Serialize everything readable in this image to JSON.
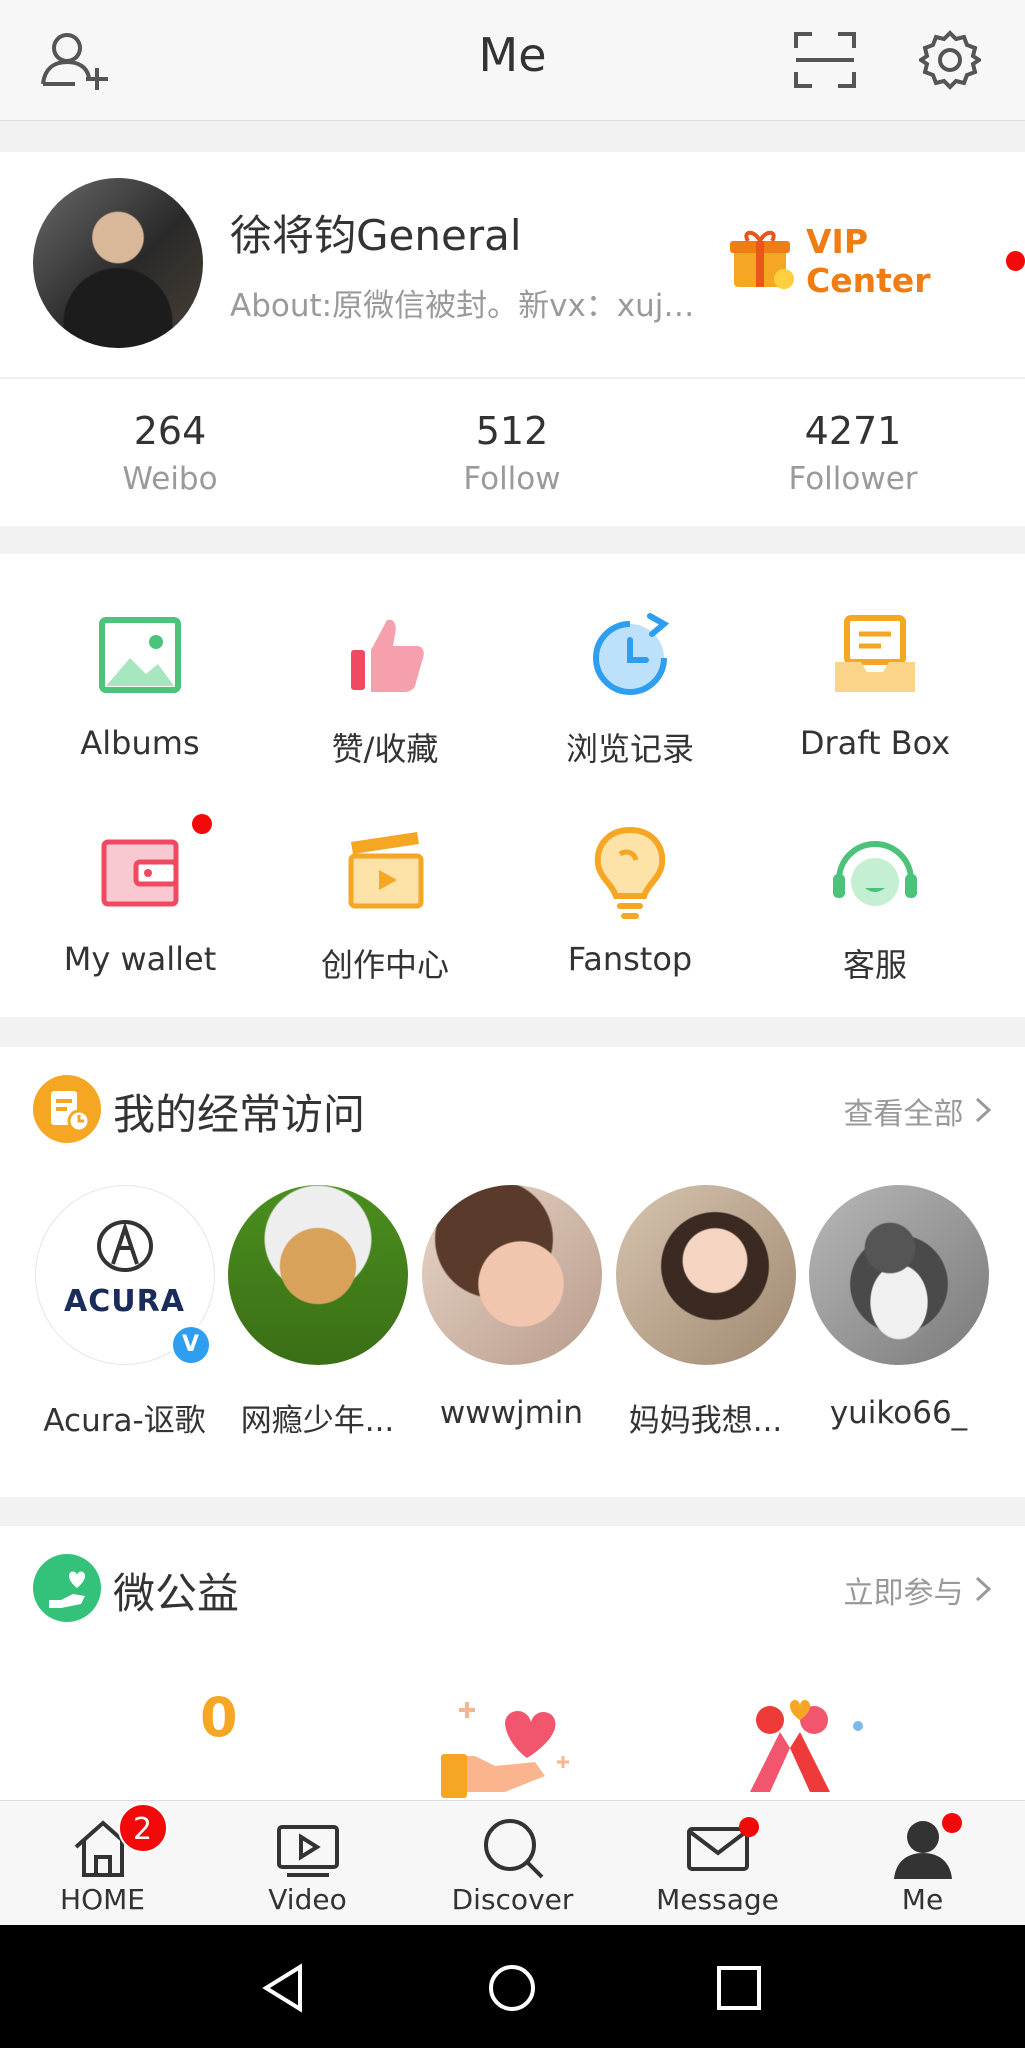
{
  "header": {
    "title": "Me"
  },
  "profile": {
    "name": "徐将钧General",
    "about": "About:原微信被封。新vx：xuj…",
    "vip_label": "VIP Center"
  },
  "stats": [
    {
      "value": "264",
      "label": "Weibo"
    },
    {
      "value": "512",
      "label": "Follow"
    },
    {
      "value": "4271",
      "label": "Follower"
    }
  ],
  "grid": [
    {
      "label": "Albums",
      "icon": "albums-icon"
    },
    {
      "label": "赞/收藏",
      "icon": "thumbs-up-icon"
    },
    {
      "label": "浏览记录",
      "icon": "history-clock-icon"
    },
    {
      "label": "Draft Box",
      "icon": "draft-box-icon"
    },
    {
      "label": "My wallet",
      "icon": "wallet-icon"
    },
    {
      "label": "创作中心",
      "icon": "clapperboard-icon"
    },
    {
      "label": "Fanstop",
      "icon": "lightbulb-icon"
    },
    {
      "label": "客服",
      "icon": "headset-icon"
    }
  ],
  "frequent": {
    "title": "我的经常访问",
    "link": "查看全部",
    "items": [
      {
        "label": "Acura-讴歌"
      },
      {
        "label": "网瘾少年..."
      },
      {
        "label": "wwwjmin"
      },
      {
        "label": "妈妈我想..."
      },
      {
        "label": "yuiko66_"
      }
    ],
    "acura_logo_text": "ACURA"
  },
  "charity": {
    "title": "微公益",
    "link": "立即参与",
    "count": "0"
  },
  "tabs": [
    {
      "label": "HOME",
      "badge": "2"
    },
    {
      "label": "Video"
    },
    {
      "label": "Discover"
    },
    {
      "label": "Message"
    },
    {
      "label": "Me"
    }
  ],
  "colors": {
    "accent": "#f07d14",
    "badge": "#f20a0a",
    "counter": "#f5a623"
  }
}
